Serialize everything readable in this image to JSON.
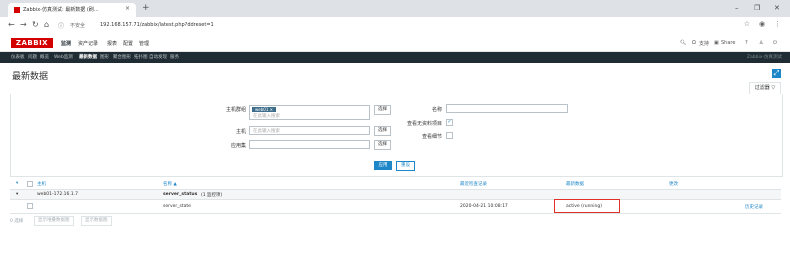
{
  "browser": {
    "tab_title": "Zabbix-仿真测试: 最新数据 (刷...",
    "tab_close": "×",
    "new_tab": "+",
    "security": "不安全",
    "url": "192.168.157.71/zabbix/latest.php?ddreset=1",
    "win_min": "–",
    "win_max": "❐",
    "win_close": "✕"
  },
  "header": {
    "logo": "ZABBIX",
    "menu": [
      "监测",
      "资产记录",
      "报表",
      "配置",
      "管理"
    ],
    "right": [
      "支持",
      "Share",
      "?"
    ]
  },
  "subnav": {
    "items": [
      "仪表板",
      "问题",
      "概览",
      "Web监测",
      "最新数据",
      "图形",
      "聚合图形",
      "拓扑图",
      "自动发现",
      "服务"
    ],
    "selected_index": 4,
    "right": "Zabbix-仿真测试"
  },
  "page": {
    "title": "最新数据",
    "filter_tab": "过滤器"
  },
  "filter": {
    "host_groups_label": "主机群组",
    "host_group_chip": "web01 ✕",
    "type_here": "在此输入搜索",
    "hosts_label": "主机",
    "hosts_placeholder": "在此输入搜索",
    "app_label": "应用集",
    "select": "选择",
    "name_label": "名称",
    "show_no_data_label": "查看无资料项目",
    "show_details_label": "查看细节",
    "apply": "应用",
    "reset": "重设"
  },
  "table": {
    "headers": [
      "主机",
      "名称 ▲",
      "最近检查记录",
      "最新数据",
      "更改"
    ],
    "group_row": {
      "host": "web01-172.16.1.7",
      "name": "server_status",
      "count": "(1 监控项)"
    },
    "item_row": {
      "name": "server_state",
      "last_check": "2020-04-21 10:08:17",
      "last_value": "active (running)",
      "history": "历史记录"
    }
  },
  "footer": {
    "selected": "0 选择",
    "btn_graph": "显示堆叠数据图",
    "btn_show": "显示数据图"
  }
}
